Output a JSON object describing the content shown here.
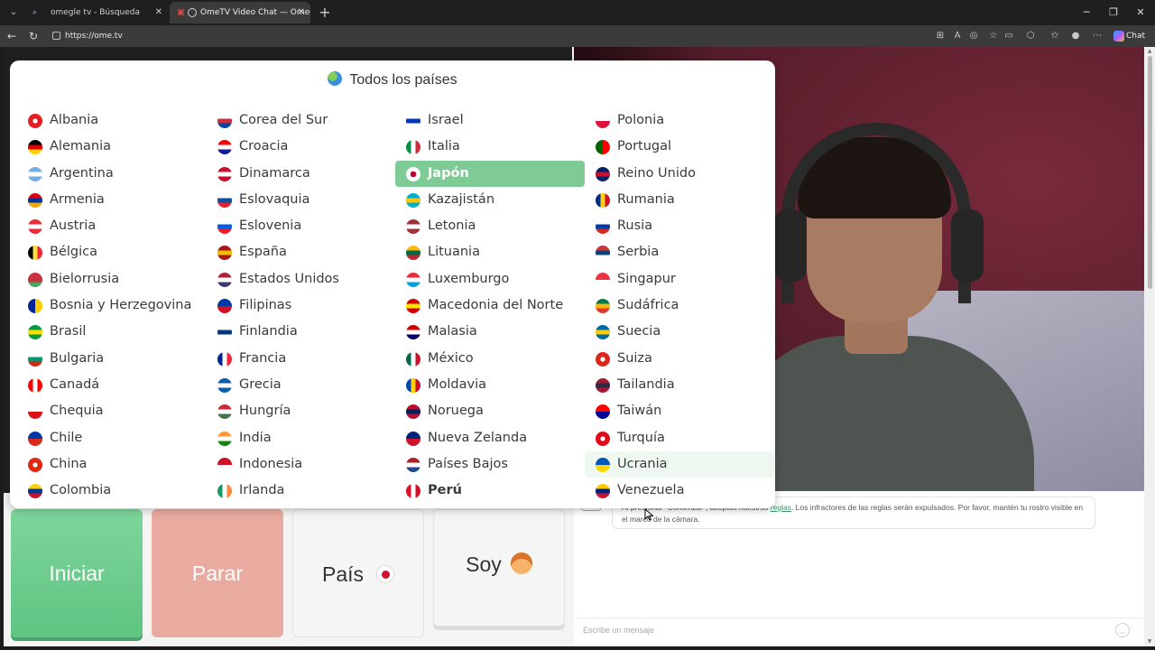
{
  "browser": {
    "tabs": [
      {
        "title": "omegle tv - Búsqueda",
        "active": false
      },
      {
        "title": "OmeTV Video Chat — Omegle",
        "active": true
      }
    ],
    "url": "https://ome.tv",
    "chat_button": "Chat"
  },
  "popup": {
    "title": "Todos los países",
    "columns": [
      [
        {
          "name": "Albania",
          "flag": [
            "#e41e20"
          ]
        },
        {
          "name": "Alemania",
          "flag": [
            "#000000",
            "#dd0000",
            "#ffce00"
          ],
          "stripes": "h"
        },
        {
          "name": "Argentina",
          "flag": [
            "#74acdf",
            "#ffffff",
            "#74acdf"
          ],
          "stripes": "h"
        },
        {
          "name": "Armenia",
          "flag": [
            "#d90012",
            "#0033a0",
            "#f2a800"
          ],
          "stripes": "h"
        },
        {
          "name": "Austria",
          "flag": [
            "#ed2939",
            "#ffffff",
            "#ed2939"
          ],
          "stripes": "h"
        },
        {
          "name": "Bélgica",
          "flag": [
            "#000000",
            "#fae042",
            "#ed2939"
          ],
          "stripes": "v"
        },
        {
          "name": "Bielorrusia",
          "flag": [
            "#c8313e",
            "#c8313e",
            "#4aa657"
          ],
          "stripes": "h"
        },
        {
          "name": "Bosnia y Herzegovina",
          "flag": [
            "#002395",
            "#fecb00"
          ],
          "stripes": "v"
        },
        {
          "name": "Brasil",
          "flag": [
            "#009c3b",
            "#ffdf00",
            "#009c3b"
          ],
          "stripes": "h"
        },
        {
          "name": "Bulgaria",
          "flag": [
            "#ffffff",
            "#00966e",
            "#d62612"
          ],
          "stripes": "h"
        },
        {
          "name": "Canadá",
          "flag": [
            "#ff0000",
            "#ffffff",
            "#ff0000"
          ],
          "stripes": "v"
        },
        {
          "name": "Chequia",
          "flag": [
            "#ffffff",
            "#d7141a"
          ],
          "stripes": "h"
        },
        {
          "name": "Chile",
          "flag": [
            "#0039a6",
            "#d52b1e"
          ],
          "stripes": "h"
        },
        {
          "name": "China",
          "flag": [
            "#de2910"
          ]
        },
        {
          "name": "Colombia",
          "flag": [
            "#fcd116",
            "#003893",
            "#ce1126"
          ],
          "stripes": "h"
        }
      ],
      [
        {
          "name": "Corea del Sur",
          "flag": [
            "#ffffff",
            "#cd2e3a",
            "#0047a0"
          ],
          "stripes": "h"
        },
        {
          "name": "Croacia",
          "flag": [
            "#ff0000",
            "#ffffff",
            "#171796"
          ],
          "stripes": "h"
        },
        {
          "name": "Dinamarca",
          "flag": [
            "#c8102e",
            "#ffffff",
            "#c8102e"
          ],
          "stripes": "h"
        },
        {
          "name": "Eslovaquia",
          "flag": [
            "#ffffff",
            "#0b4ea2",
            "#ee1c25"
          ],
          "stripes": "h"
        },
        {
          "name": "Eslovenia",
          "flag": [
            "#ffffff",
            "#005ce5",
            "#ed1c24"
          ],
          "stripes": "h"
        },
        {
          "name": "España",
          "flag": [
            "#aa151b",
            "#f1bf00",
            "#aa151b"
          ],
          "stripes": "h"
        },
        {
          "name": "Estados Unidos",
          "flag": [
            "#b22234",
            "#ffffff",
            "#3c3b6e"
          ],
          "stripes": "h"
        },
        {
          "name": "Filipinas",
          "flag": [
            "#0038a8",
            "#ce1126"
          ],
          "stripes": "h"
        },
        {
          "name": "Finlandia",
          "flag": [
            "#ffffff",
            "#003580",
            "#ffffff"
          ],
          "stripes": "h"
        },
        {
          "name": "Francia",
          "flag": [
            "#002395",
            "#ffffff",
            "#ed2939"
          ],
          "stripes": "v"
        },
        {
          "name": "Grecia",
          "flag": [
            "#0d5eaf",
            "#ffffff",
            "#0d5eaf"
          ],
          "stripes": "h"
        },
        {
          "name": "Hungría",
          "flag": [
            "#ce2939",
            "#ffffff",
            "#477050"
          ],
          "stripes": "h"
        },
        {
          "name": "India",
          "flag": [
            "#ff9933",
            "#ffffff",
            "#138808"
          ],
          "stripes": "h"
        },
        {
          "name": "Indonesia",
          "flag": [
            "#ce1126",
            "#ffffff"
          ],
          "stripes": "h"
        },
        {
          "name": "Irlanda",
          "flag": [
            "#169b62",
            "#ffffff",
            "#ff883e"
          ],
          "stripes": "v"
        }
      ],
      [
        {
          "name": "Israel",
          "flag": [
            "#ffffff",
            "#0038b8",
            "#ffffff"
          ],
          "stripes": "h"
        },
        {
          "name": "Italia",
          "flag": [
            "#009246",
            "#ffffff",
            "#ce2b37"
          ],
          "stripes": "v"
        },
        {
          "name": "Japón",
          "flag": [
            "#ffffff"
          ],
          "selected": true
        },
        {
          "name": "Kazajistán",
          "flag": [
            "#00afca",
            "#fec50c",
            "#00afca"
          ],
          "stripes": "h"
        },
        {
          "name": "Letonia",
          "flag": [
            "#9e3039",
            "#ffffff",
            "#9e3039"
          ],
          "stripes": "h"
        },
        {
          "name": "Lituania",
          "flag": [
            "#fdb913",
            "#006a44",
            "#c1272d"
          ],
          "stripes": "h"
        },
        {
          "name": "Luxemburgo",
          "flag": [
            "#ed2939",
            "#ffffff",
            "#00a1de"
          ],
          "stripes": "h"
        },
        {
          "name": "Macedonia del Norte",
          "flag": [
            "#d20000",
            "#ffe600",
            "#d20000"
          ],
          "stripes": "h"
        },
        {
          "name": "Malasia",
          "flag": [
            "#cc0001",
            "#ffffff",
            "#010066"
          ],
          "stripes": "h"
        },
        {
          "name": "México",
          "flag": [
            "#006847",
            "#ffffff",
            "#ce1126"
          ],
          "stripes": "v"
        },
        {
          "name": "Moldavia",
          "flag": [
            "#0046ae",
            "#ffd200",
            "#cc092f"
          ],
          "stripes": "v"
        },
        {
          "name": "Noruega",
          "flag": [
            "#ba0c2f",
            "#00205b",
            "#ba0c2f"
          ],
          "stripes": "h"
        },
        {
          "name": "Nueva Zelanda",
          "flag": [
            "#00247d",
            "#cc142b"
          ],
          "stripes": "h"
        },
        {
          "name": "Países Bajos",
          "flag": [
            "#ae1c28",
            "#ffffff",
            "#21468b"
          ],
          "stripes": "h"
        },
        {
          "name": "Perú",
          "flag": [
            "#d91023",
            "#ffffff",
            "#d91023"
          ],
          "stripes": "v",
          "bold": true
        }
      ],
      [
        {
          "name": "Polonia",
          "flag": [
            "#ffffff",
            "#dc143c"
          ],
          "stripes": "h"
        },
        {
          "name": "Portugal",
          "flag": [
            "#006600",
            "#ff0000"
          ],
          "stripes": "v"
        },
        {
          "name": "Reino Unido",
          "flag": [
            "#012169",
            "#c8102e",
            "#012169"
          ],
          "stripes": "h"
        },
        {
          "name": "Rumania",
          "flag": [
            "#002b7f",
            "#fcd116",
            "#ce1126"
          ],
          "stripes": "v"
        },
        {
          "name": "Rusia",
          "flag": [
            "#ffffff",
            "#0039a6",
            "#d52b1e"
          ],
          "stripes": "h"
        },
        {
          "name": "Serbia",
          "flag": [
            "#c6363c",
            "#0c4076",
            "#ffffff"
          ],
          "stripes": "h"
        },
        {
          "name": "Singapur",
          "flag": [
            "#ef3340",
            "#ffffff"
          ],
          "stripes": "h"
        },
        {
          "name": "Sudáfrica",
          "flag": [
            "#007a4d",
            "#ffb612",
            "#de3831"
          ],
          "stripes": "h"
        },
        {
          "name": "Suecia",
          "flag": [
            "#006aa7",
            "#fecc00",
            "#006aa7"
          ],
          "stripes": "h"
        },
        {
          "name": "Suiza",
          "flag": [
            "#da291c"
          ]
        },
        {
          "name": "Tailandia",
          "flag": [
            "#a51931",
            "#2d2a4a",
            "#a51931"
          ],
          "stripes": "h"
        },
        {
          "name": "Taiwán",
          "flag": [
            "#fe0000",
            "#000095"
          ],
          "stripes": "h"
        },
        {
          "name": "Turquía",
          "flag": [
            "#e30a17"
          ]
        },
        {
          "name": "Ucrania",
          "flag": [
            "#0057b7",
            "#ffd700"
          ],
          "stripes": "h",
          "hover": true
        },
        {
          "name": "Venezuela",
          "flag": [
            "#ffcc00",
            "#00247d",
            "#cf142b"
          ],
          "stripes": "h"
        }
      ]
    ]
  },
  "controls": {
    "start_label": "Iniciar",
    "stop_label": "Parar",
    "country_label": "País",
    "iam_label": "Soy"
  },
  "chat": {
    "message_before_link": "Al presionar \"Comenzar\", aceptas nuestras ",
    "message_link": "reglas",
    "message_after_link": ". Los infractores de las reglas serán expulsados. Por favor, mantén tu rostro visible en el marco de la cámara.",
    "input_placeholder": "Escribe un mensaje"
  }
}
